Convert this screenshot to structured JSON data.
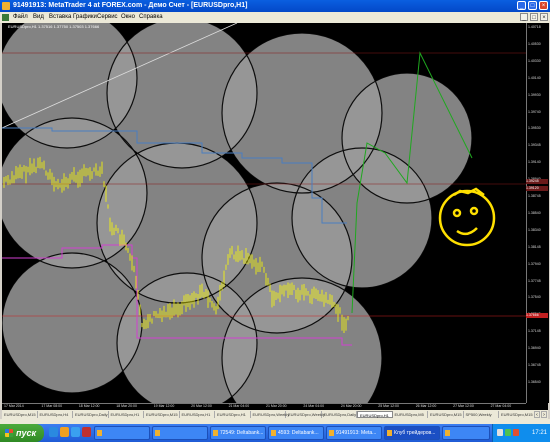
{
  "window": {
    "title": "91491913: MetaTrader 4 at FOREX.com - Демо Счет - [EURUSDpro,H1]",
    "controls": [
      "_",
      "□",
      "×"
    ]
  },
  "menu": {
    "items": [
      "Файл",
      "Вид",
      "Вставка",
      "Графики",
      "Сервис",
      "Окно",
      "Справка"
    ]
  },
  "chart": {
    "symbol_label": "EURUSDpro,H1  1.37516 1.37750 1.37503 1.37666",
    "price_ticks": [
      "1.40718",
      "1.40530",
      "1.40330",
      "1.40140",
      "1.39930",
      "1.39740",
      "1.39530",
      "1.39345",
      "1.39140",
      "1.38940",
      "1.38745",
      "1.38540",
      "1.38340",
      "1.38145",
      "1.37940",
      "1.37745",
      "1.37540",
      "1.37345",
      "1.37145",
      "1.36940",
      "1.36745",
      "1.36540"
    ],
    "price_tags": [
      "1.39245",
      "1.39120",
      "1.37666"
    ],
    "time_ticks": [
      "17 Mar 2014",
      "17 Mar 08:00",
      "18 Mar 12:00",
      "18 Mar 20:00",
      "19 Mar 12:00",
      "20 Mar 12:00",
      "21 Mar 04:00",
      "21 Mar 20:00",
      "24 Mar 04:00",
      "24 Mar 20:00",
      "25 Mar 12:00",
      "26 Mar 12:00",
      "27 Mar 12:00",
      "27 Mar 04:00"
    ],
    "colors": {
      "background": "#000000",
      "candles": "#ffff00",
      "circles": "#9a9a9a",
      "blue_line": "#4a7ec0",
      "magenta_line": "#d040d0",
      "green_line": "#1fa81f",
      "smiley": "#ffe000"
    }
  },
  "tabs": {
    "items": [
      "EURUSDpro,M15",
      "EURUSDpro,H4",
      "EURUSDpro,Daily",
      "EURUSDpro,H1",
      "EURUSDpro,M15",
      "EURUSDpro,H1",
      "EURUSDpro,H1",
      "EURUSDpro,Weekly",
      "EURUSDpro,Weekly",
      "EURUSDpro,Daily",
      "EURUSDpro,H1",
      "EURUSDpro,M5",
      "EURUSDpro,M15",
      "SP500,Weekly",
      "EURUSDpro,M15"
    ],
    "active_index": 10
  },
  "taskbar": {
    "start_label": "пуск",
    "buttons": [
      "",
      "",
      "72549: Deltabank...",
      "4593: Deltabank...",
      "91491913: Meta...",
      "Клуб трейдеров..."
    ],
    "clock": "17:21"
  }
}
